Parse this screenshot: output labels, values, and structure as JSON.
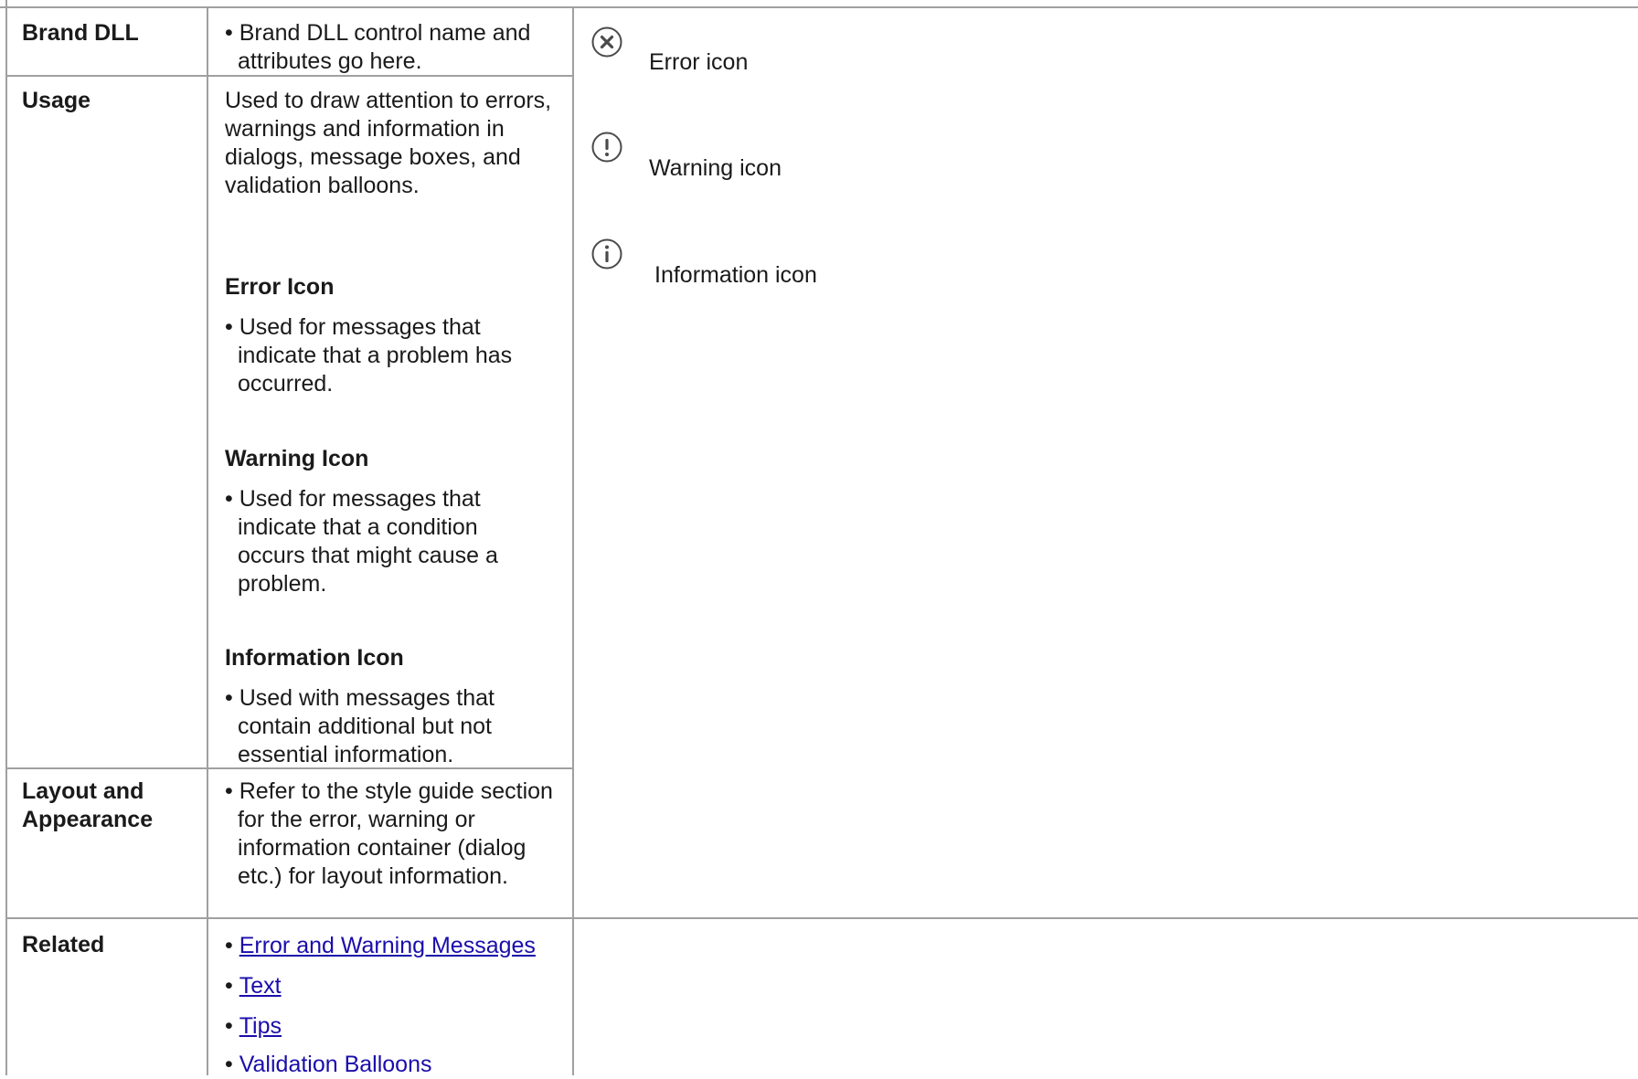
{
  "rows": {
    "brand": {
      "label": "Brand DLL",
      "bullet": "• Brand DLL control name and attributes go here."
    },
    "usage": {
      "label": "Usage",
      "intro": "Used to draw attention to errors, warnings and information in dialogs, message boxes, and validation balloons.",
      "error_heading": "Error Icon",
      "error_bullet": "• Used for messages that indicate that a problem has occurred.",
      "warning_heading": "Warning Icon",
      "warning_bullet": "• Used for messages that indicate that a condition occurs that might cause a problem.",
      "info_heading": "Information Icon",
      "info_bullet": "• Used with messages that contain additional but not essential information."
    },
    "layout": {
      "label": "Layout and Appearance",
      "bullet": "• Refer to the style guide section for the error, warning or information container (dialog etc.) for layout information."
    },
    "related": {
      "label": "Related",
      "links": [
        "Error and Warning Messages",
        "Text",
        "Tips",
        "Validation Balloons"
      ]
    }
  },
  "samples": {
    "error": {
      "icon": "error-icon",
      "label": "Error icon"
    },
    "warning": {
      "icon": "warning-icon",
      "label": "Warning icon"
    },
    "info": {
      "icon": "information-icon",
      "label": "Information icon"
    }
  },
  "colors": {
    "border": "#a0a0a0",
    "link": "#1a0dab",
    "icon": "#4a4a4a"
  }
}
